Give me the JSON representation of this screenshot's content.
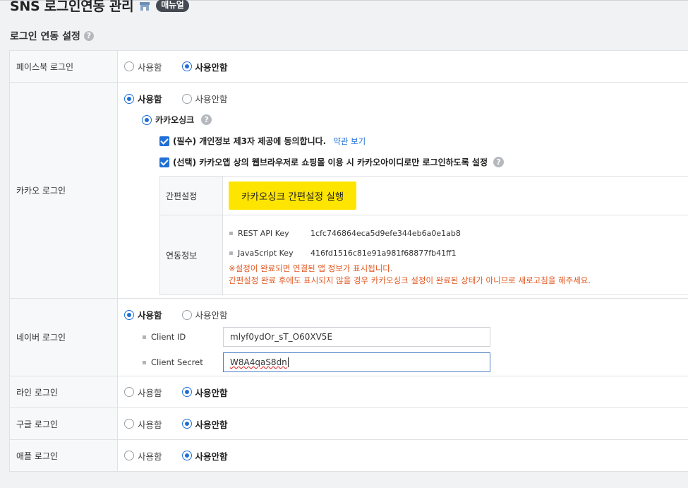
{
  "header": {
    "title": "SNS 로그인연동 관리",
    "manual_badge": "매뉴얼"
  },
  "section": {
    "title": "로그인 연동 설정",
    "help": "?"
  },
  "options": {
    "use": "사용함",
    "not_use": "사용안함"
  },
  "rows": {
    "facebook": {
      "label": "페이스북 로그인",
      "selected": "not_use"
    },
    "kakao": {
      "label": "카카오 로그인",
      "selected": "use",
      "sync_label": "카카오싱크",
      "agree_required": "(필수) 개인정보 제3자 제공에 동의합니다.",
      "terms_link": "약관 보기",
      "agree_optional": "(선택) 카카오앱 상의 웹브라우저로 쇼핑몰 이용 시 카카오아이디로만 로그인하도록 설정",
      "quick_setup_label": "간편설정",
      "quick_setup_button": "카카오싱크 간편설정 실행",
      "link_info_label": "연동정보",
      "rest_api_key_label": "REST API Key",
      "rest_api_key": "1cfc746864eca5d9efe344eb6a0e1ab8",
      "js_key_label": "JavaScript Key",
      "js_key": "416fd1516c81e91a981f68877fb41ff1",
      "notice_1": "※설정이 완료되면 연결된 앱 정보가 표시됩니다.",
      "notice_2": "간편설정 완료 후에도 표시되지 않을 경우 카카오싱크 설정이 완료된 상태가 아니므로 새로고침을 해주세요."
    },
    "naver": {
      "label": "네이버 로그인",
      "selected": "use",
      "client_id_label": "Client ID",
      "client_id": "mlyf0ydOr_sT_O60XV5E",
      "client_secret_label": "Client Secret",
      "client_secret": "W8A4qaS8dn"
    },
    "line": {
      "label": "라인 로그인",
      "selected": "not_use"
    },
    "google": {
      "label": "구글 로그인",
      "selected": "not_use"
    },
    "apple": {
      "label": "애플 로그인",
      "selected": "not_use"
    }
  },
  "colors": {
    "accent": "#1f6fd6",
    "kakao_yellow": "#fee500",
    "warning": "#e25822"
  }
}
